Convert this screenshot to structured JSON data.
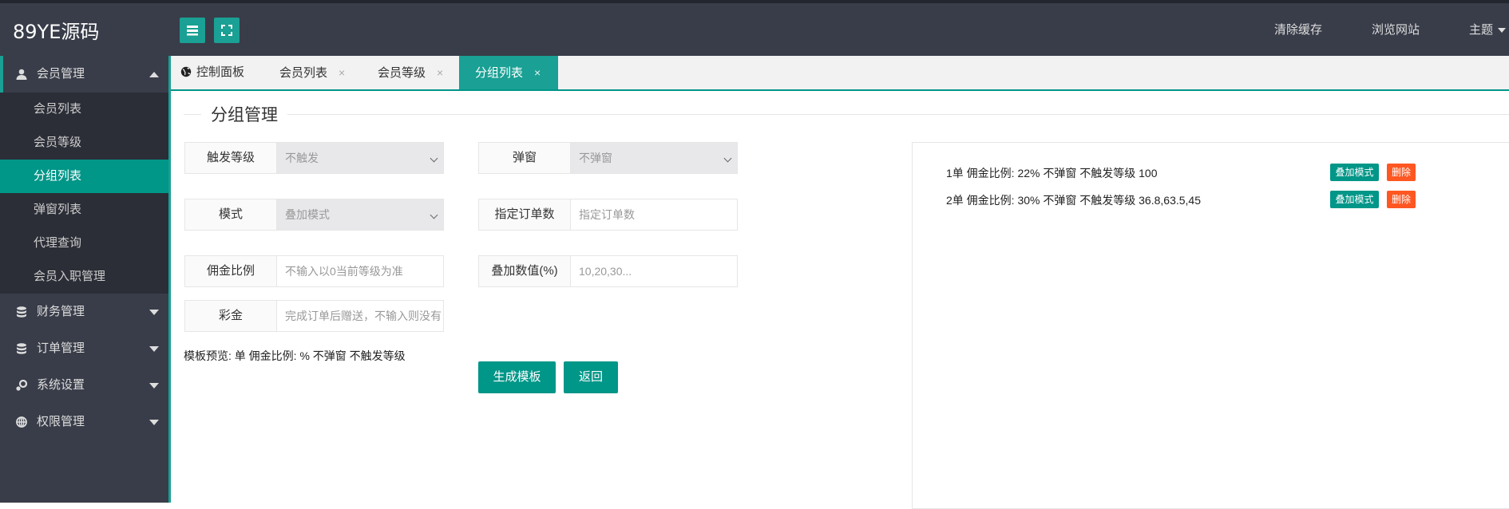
{
  "app": {
    "logo": "89YE源码"
  },
  "header": {
    "menu_icon": "list-icon",
    "fullscreen_icon": "fullscreen-icon",
    "nav": [
      "清除缓存",
      "浏览网站",
      "主题"
    ]
  },
  "sidebar": {
    "groups": [
      {
        "label": "会员管理",
        "icon": "user-icon",
        "open": true,
        "items": [
          "会员列表",
          "会员等级",
          "分组列表",
          "弹窗列表",
          "代理查询",
          "会员入职管理"
        ],
        "active": "分组列表"
      },
      {
        "label": "财务管理",
        "icon": "database-icon"
      },
      {
        "label": "订单管理",
        "icon": "database-icon"
      },
      {
        "label": "系统设置",
        "icon": "settings-icon"
      },
      {
        "label": "权限管理",
        "icon": "globe-icon"
      }
    ]
  },
  "tabs": [
    {
      "label": "控制面板",
      "icon": "globe-icon",
      "closable": false
    },
    {
      "label": "会员列表",
      "closable": true
    },
    {
      "label": "会员等级",
      "closable": true
    },
    {
      "label": "分组列表",
      "closable": true,
      "active": true
    }
  ],
  "tab_close": "×",
  "page": {
    "legend": "分组管理",
    "form": {
      "trigger_level": {
        "label": "触发等级",
        "value": "不触发"
      },
      "popup": {
        "label": "弹窗",
        "value": "不弹窗"
      },
      "mode": {
        "label": "模式",
        "value": "叠加模式"
      },
      "order_count": {
        "label": "指定订单数",
        "placeholder": "指定订单数"
      },
      "commission": {
        "label": "佣金比例",
        "placeholder": "不输入以0当前等级为准"
      },
      "stack_value": {
        "label": "叠加数值(%)",
        "placeholder": "10,20,30..."
      },
      "bonus": {
        "label": "彩金",
        "placeholder": "完成订单后赠送，不输入则没有"
      }
    },
    "preview": "模板预览: 单 佣金比例: % 不弹窗 不触发等级",
    "buttons": {
      "generate": "生成模板",
      "back": "返回"
    },
    "templates": [
      {
        "text": "1单 佣金比例: 22% 不弹窗 不触发等级 100",
        "mode": "叠加模式",
        "delete": "删除"
      },
      {
        "text": "2单 佣金比例: 30% 不弹窗 不触发等级 36.8,63.5,45",
        "mode": "叠加模式",
        "delete": "删除"
      }
    ]
  }
}
